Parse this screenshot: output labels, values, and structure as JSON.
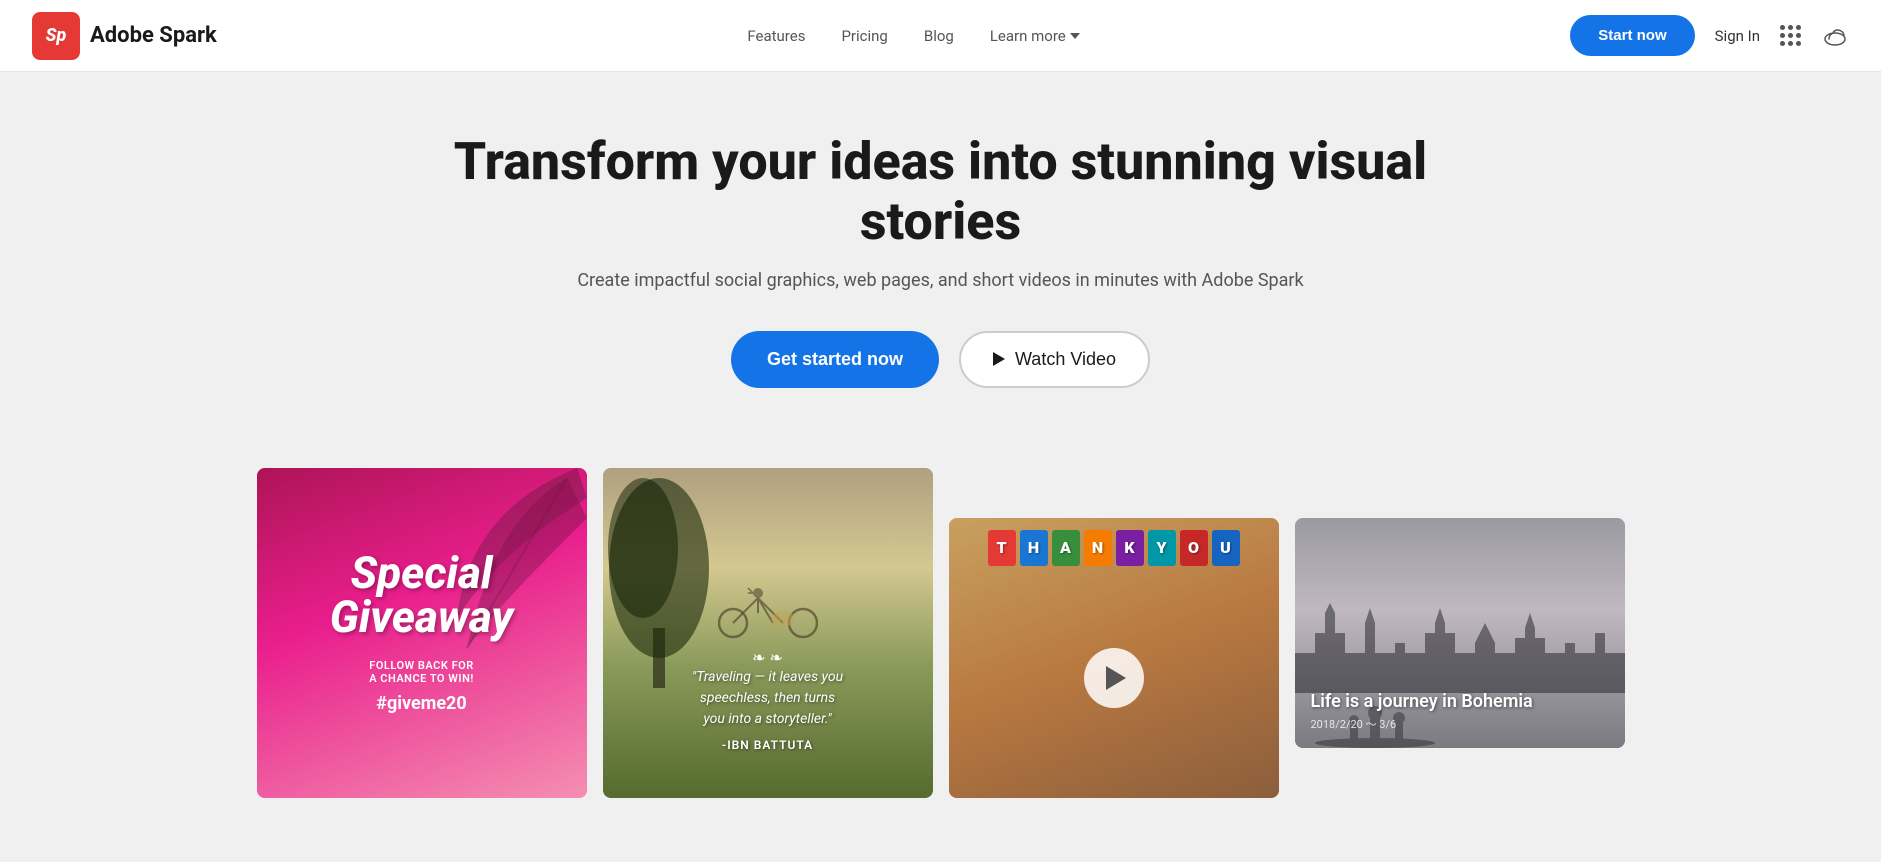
{
  "brand": {
    "logo_initials": "Sp",
    "name": "Adobe Spark"
  },
  "nav": {
    "links": [
      {
        "id": "features",
        "label": "Features"
      },
      {
        "id": "pricing",
        "label": "Pricing"
      },
      {
        "id": "blog",
        "label": "Blog"
      },
      {
        "id": "learn-more",
        "label": "Learn more",
        "has_arrow": true
      }
    ],
    "sign_in_label": "Sign In",
    "start_now_label": "Start now"
  },
  "hero": {
    "title": "Transform your ideas into stunning visual stories",
    "subtitle": "Create impactful social graphics, web pages, and short videos in minutes with Adobe Spark",
    "cta_primary": "Get started now",
    "cta_secondary": "Watch Video"
  },
  "gallery": {
    "cards": [
      {
        "id": "special-giveaway",
        "type": "social-graphic",
        "title": "Special\nGiveaway",
        "sub": "Follow back for a chance to win!",
        "hashtag": "#giveme20",
        "bg_color": "#c2185b"
      },
      {
        "id": "travel-quote",
        "type": "quote-graphic",
        "quote": "Traveling — it leaves you speechless, then turns you into a storyteller.",
        "author": "-IBN BATTUTA",
        "bg_color": "#556b2f"
      },
      {
        "id": "thank-you-video",
        "type": "video",
        "letters": [
          "T",
          "H",
          "A",
          "N",
          "K",
          "Y",
          "O",
          "U"
        ],
        "bg_color": "#c8a060"
      },
      {
        "id": "bohemia-story",
        "type": "web-story",
        "title": "Life is a journey in Bohemia",
        "date": "2018/2/20 ～ 3/6",
        "bg_color": "#888888"
      }
    ]
  },
  "colors": {
    "primary_blue": "#1473e6",
    "hero_bg": "#f0f0f0",
    "text_dark": "#1a1a1a",
    "text_muted": "#555555"
  }
}
